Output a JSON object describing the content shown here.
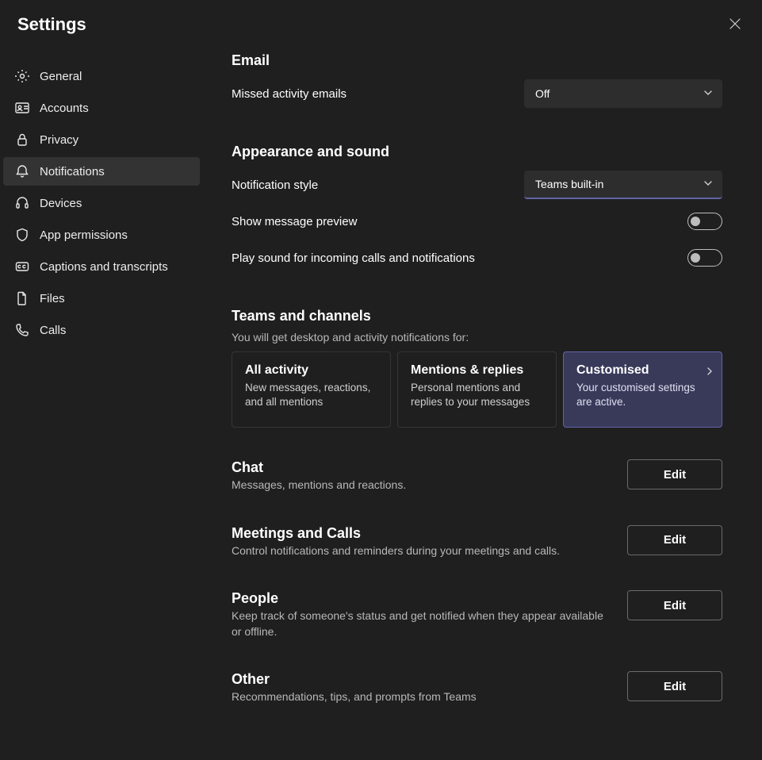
{
  "header": {
    "title": "Settings"
  },
  "sidebar": {
    "items": [
      {
        "label": "General"
      },
      {
        "label": "Accounts"
      },
      {
        "label": "Privacy"
      },
      {
        "label": "Notifications"
      },
      {
        "label": "Devices"
      },
      {
        "label": "App permissions"
      },
      {
        "label": "Captions and transcripts"
      },
      {
        "label": "Files"
      },
      {
        "label": "Calls"
      }
    ],
    "active_index": 3
  },
  "sections": {
    "email": {
      "title": "Email",
      "missed_label": "Missed activity emails",
      "missed_value": "Off"
    },
    "appearance": {
      "title": "Appearance and sound",
      "style_label": "Notification style",
      "style_value": "Teams built-in",
      "preview_label": "Show message preview",
      "preview_on": false,
      "sound_label": "Play sound for incoming calls and notifications",
      "sound_on": false
    },
    "teams_channels": {
      "title": "Teams and channels",
      "subtitle": "You will get desktop and activity notifications for:",
      "cards": [
        {
          "title": "All activity",
          "desc": "New messages, reactions, and all mentions"
        },
        {
          "title": "Mentions & replies",
          "desc": "Personal mentions and replies to your messages"
        },
        {
          "title": "Customised",
          "desc": "Your customised settings are active."
        }
      ],
      "selected_index": 2
    },
    "chat": {
      "title": "Chat",
      "desc": "Messages, mentions and reactions.",
      "button": "Edit"
    },
    "meetings": {
      "title": "Meetings and Calls",
      "desc": "Control notifications and reminders during your meetings and calls.",
      "button": "Edit"
    },
    "people": {
      "title": "People",
      "desc": "Keep track of someone's status and get notified when they appear available or offline.",
      "button": "Edit"
    },
    "other": {
      "title": "Other",
      "desc": "Recommendations, tips, and prompts from Teams",
      "button": "Edit"
    }
  }
}
